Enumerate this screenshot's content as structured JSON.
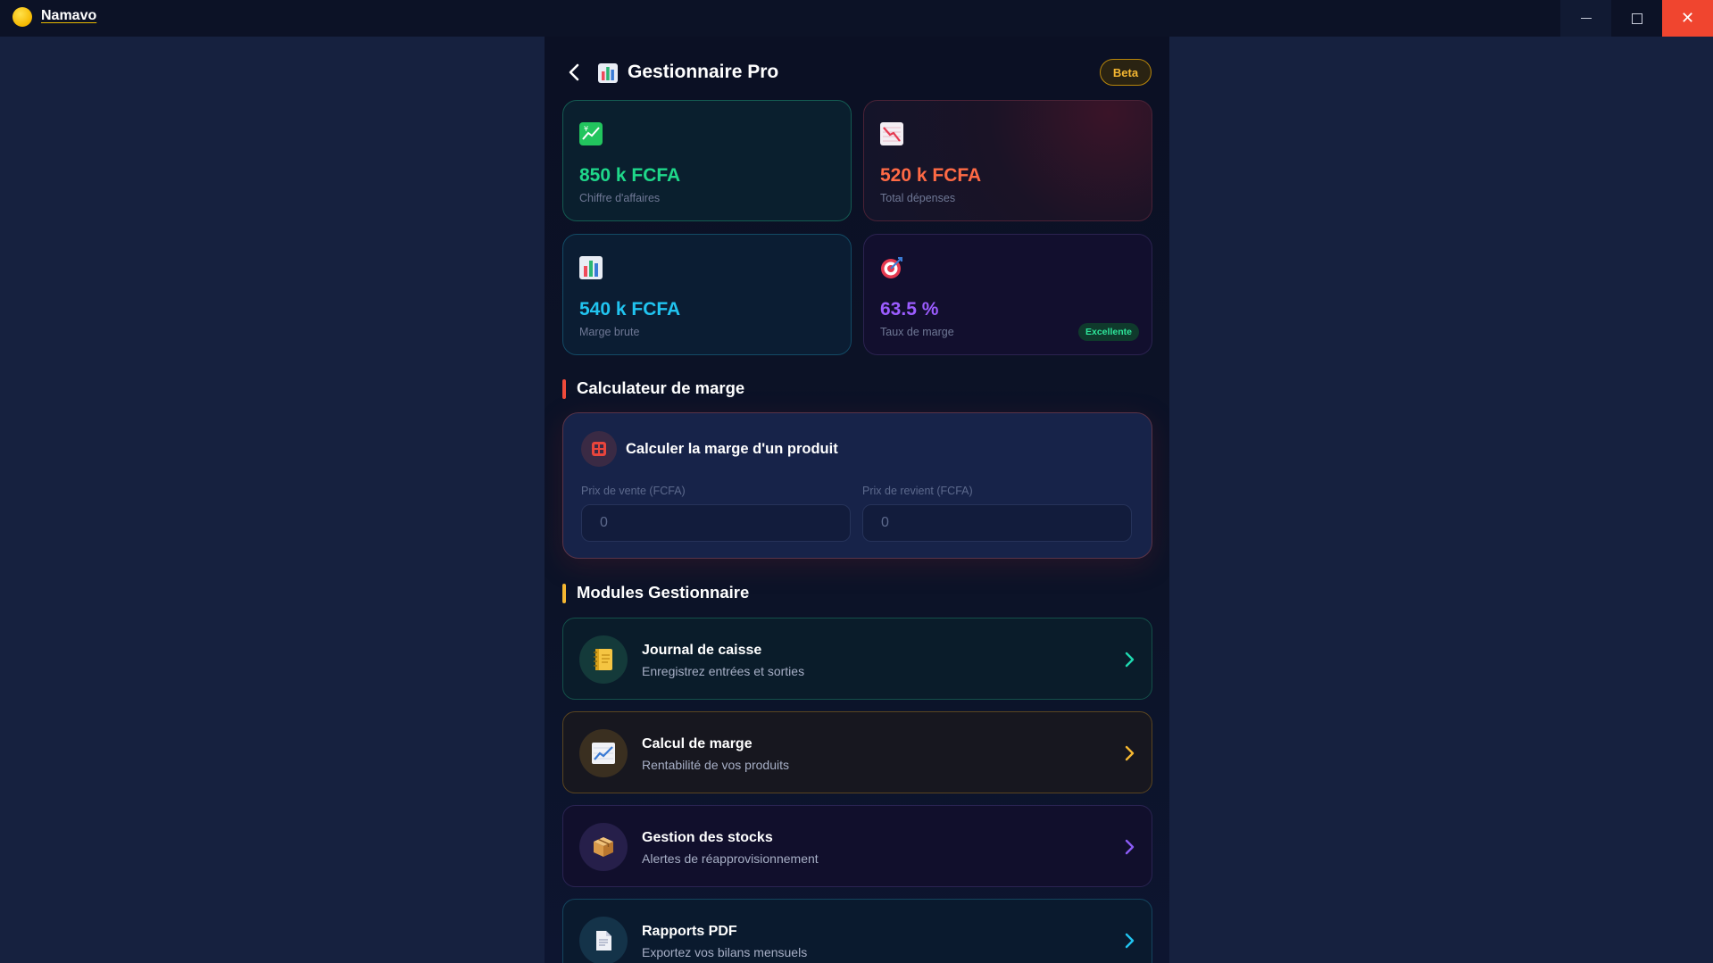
{
  "window": {
    "app_title": "Namavo",
    "min_label": "–",
    "close_label": "✕"
  },
  "header": {
    "title": "Gestionnaire Pro",
    "badge": "Beta"
  },
  "stats": [
    {
      "value": "850 k FCFA",
      "label": "Chiffre d'affaires",
      "icon": "chart-up-icon"
    },
    {
      "value": "520 k FCFA",
      "label": "Total dépenses",
      "icon": "chart-down-icon"
    },
    {
      "value": "540 k FCFA",
      "label": "Marge brute",
      "icon": "bar-chart-icon"
    },
    {
      "value": "63.5 %",
      "label": "Taux de marge",
      "icon": "target-icon",
      "badge": "Excellente"
    }
  ],
  "calculator": {
    "section_title": "Calculateur de marge",
    "card_title": "Calculer la marge d'un produit",
    "sale_price_label": "Prix de vente (FCFA)",
    "sale_price_placeholder": "0",
    "cost_price_label": "Prix de revient (FCFA)",
    "cost_price_placeholder": "0"
  },
  "modules": {
    "section_title": "Modules Gestionnaire",
    "items": [
      {
        "title": "Journal de caisse",
        "subtitle": "Enregistrez entrées et sorties",
        "icon": "notebook-icon",
        "accent": "#1fd8b0"
      },
      {
        "title": "Calcul de marge",
        "subtitle": "Rentabilité de vos produits",
        "icon": "chart-up-icon",
        "accent": "#f5b731"
      },
      {
        "title": "Gestion des stocks",
        "subtitle": "Alertes de réapprovisionnement",
        "icon": "package-icon",
        "accent": "#8b5cf6"
      },
      {
        "title": "Rapports PDF",
        "subtitle": "Exportez vos bilans mensuels",
        "icon": "document-icon",
        "accent": "#21c4f0"
      }
    ]
  },
  "colors": {
    "revenue": "#1fd88a",
    "expenses": "#ff6a45",
    "margin": "#21c4f0",
    "rate": "#9b5cff",
    "close_button": "#f0452f"
  }
}
